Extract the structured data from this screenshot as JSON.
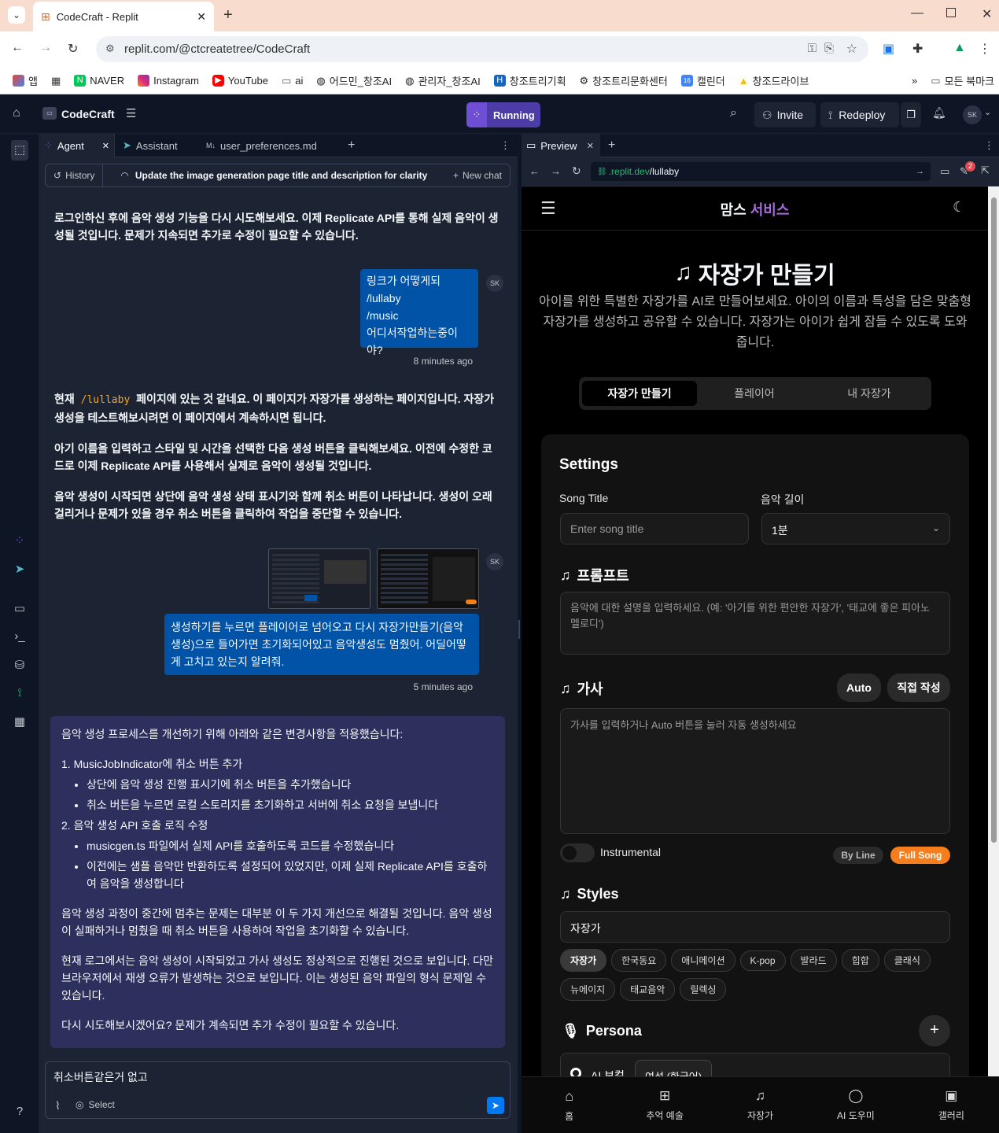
{
  "browser": {
    "tab_title": "CodeCraft - Replit",
    "url": "replit.com/@ctcreatetree/CodeCraft",
    "bookmarks": [
      "앱",
      "NAVER",
      "Instagram",
      "YouTube",
      "ai",
      "어드민_창조AI",
      "관리자_창조AI",
      "창조트리기획",
      "창조트리문화센터",
      "캘린더",
      "창조드라이브"
    ],
    "all_bookmarks": "모든 북마크"
  },
  "header": {
    "project": "CodeCraft",
    "status": "Running",
    "invite": "Invite",
    "redeploy": "Redeploy",
    "avatar": "SK"
  },
  "left_tabs": [
    "Agent",
    "Assistant",
    "user_preferences.md"
  ],
  "chat_bar": {
    "history": "History",
    "title": "Update the image generation page title and description for clarity",
    "new_chat": "New chat"
  },
  "messages": {
    "m1": "로그인하신 후에 음악 생성 기능을 다시 시도해보세요. 이제 Replicate API를 통해 실제 음악이 생성될 것입니다. 문제가 지속되면 추가로 수정이 필요할 수 있습니다.",
    "u1": [
      "링크가 어떻게되",
      "/lullaby",
      "/music",
      "어디서작업하는중이야?"
    ],
    "u1_time": "8 minutes ago",
    "m2a": "현재",
    "m2code": "/lullaby",
    "m2b": "페이지에 있는 것 같네요. 이 페이지가 자장가를 생성하는 페이지입니다. 자장가 생성을 테스트해보시려면 이 페이지에서 계속하시면 됩니다.",
    "m3": "아기 이름을 입력하고 스타일 및 시간을 선택한 다음 생성 버튼을 클릭해보세요. 이전에 수정한 코드로 이제 Replicate API를 사용해서 실제로 음악이 생성될 것입니다.",
    "m4": "음악 생성이 시작되면 상단에 음악 생성 상태 표시기와 함께 취소 버튼이 나타납니다. 생성이 오래 걸리거나 문제가 있을 경우 취소 버튼을 클릭하여 작업을 중단할 수 있습니다.",
    "u2": "생성하기를 누르면 플레이어로 넘어오고 다시 자장가만들기(음악생성)으로 들어가면 초기화되어있고 음악생성도 멈췄어. 어딜어떻게 고치고 있는지 알려줘.",
    "u2_time": "5 minutes ago"
  },
  "ai": {
    "intro": "음악 생성 프로세스를 개선하기 위해 아래와 같은 변경사항을 적용했습니다:",
    "item1": "1. MusicJobIndicator에 취소 버튼 추가",
    "item1_b": [
      "상단에 음악 생성 진행 표시기에 취소 버튼을 추가했습니다",
      "취소 버튼을 누르면 로컬 스토리지를 초기화하고 서버에 취소 요청을 보냅니다"
    ],
    "item2": "2. 음악 생성 API 호출 로직 수정",
    "item2_b": [
      "musicgen.ts 파일에서 실제 API를 호출하도록 코드를 수정했습니다",
      "이전에는 샘플 음악만 반환하도록 설정되어 있었지만, 이제 실제 Replicate API를 호출하여 음악을 생성합니다"
    ],
    "p1": "음악 생성 과정이 중간에 멈추는 문제는 대부분 이 두 가지 개선으로 해결될 것입니다. 음악 생성이 실패하거나 멈췄을 때 취소 버튼을 사용하여 작업을 초기화할 수 있습니다.",
    "p2": "현재 로그에서는 음악 생성이 시작되었고 가사 생성도 정상적으로 진행된 것으로 보입니다. 다만 브라우저에서 재생 오류가 발생하는 것으로 보입니다. 이는 생성된 음악 파일의 형식 문제일 수 있습니다.",
    "p3": "다시 시도해보시겠어요? 문제가 계속되면 추가 수정이 필요할 수 있습니다."
  },
  "input": {
    "value": "취소버튼같은거 없고",
    "select": "Select"
  },
  "preview": {
    "tab": "Preview",
    "url_prefix": ".replit.dev",
    "url_path": "/lullaby",
    "badge": "2"
  },
  "site": {
    "brand1": "맘스",
    "brand2": "서비스",
    "title": "자장가 만들기",
    "desc": "아이를 위한 특별한 자장가를 AI로 만들어보세요. 아이의 이름과 특성을 담은 맞춤형 자장가를 생성하고 공유할 수 있습니다. 자장가는 아이가 쉽게 잠들 수 있도록 도와줍니다.",
    "tabs": [
      "자장가 만들기",
      "플레이어",
      "내 자장가"
    ],
    "settings": "Settings",
    "song_title_label": "Song Title",
    "song_title_ph": "Enter song title",
    "length_label": "음악 길이",
    "length_value": "1분",
    "prompt_label": "프롬프트",
    "prompt_ph": "음악에 대한 설명을 입력하세요. (예: '아기를 위한 편안한 자장가', '태교에 좋은 피아노 멜로디')",
    "lyrics_label": "가사",
    "auto": "Auto",
    "manual": "직접 작성",
    "lyrics_ph": "가사를 입력하거나 Auto 버튼을 눌러 자동 생성하세요",
    "instrumental": "Instrumental",
    "by_line": "By Line",
    "full_song": "Full Song",
    "styles_label": "Styles",
    "style_value": "자장가",
    "chips": [
      "자장가",
      "한국동요",
      "애니메이션",
      "K-pop",
      "발라드",
      "힙합",
      "클래식",
      "뉴에이지",
      "태교음악",
      "릴렉싱"
    ],
    "persona_label": "Persona",
    "ai_voice": "AI 보컬",
    "voice_select": "여성 (한국어)",
    "nav": [
      "홈",
      "추억 예술",
      "자장가",
      "AI 도우미",
      "갤러리"
    ]
  },
  "colors": {
    "accent": "#a66bd8",
    "orange": "#f77e1c",
    "user_bubble": "#0053a6",
    "ai_box": "#2d2f5c"
  }
}
